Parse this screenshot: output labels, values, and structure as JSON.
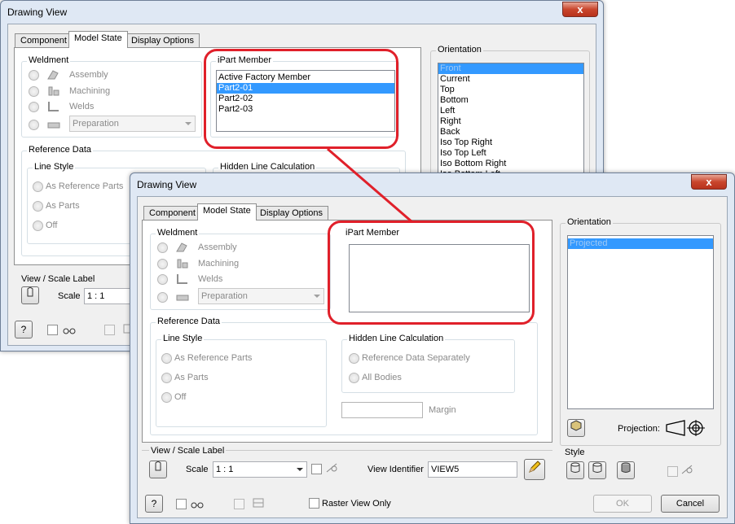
{
  "back": {
    "title": "Drawing View",
    "close": "x",
    "tabs": [
      "Component",
      "Model State",
      "Display Options"
    ],
    "weldment": {
      "label": "Weldment",
      "items": [
        "Assembly",
        "Machining",
        "Welds"
      ],
      "combo": "Preparation"
    },
    "ipart": {
      "label": "iPart Member",
      "items": [
        "Active Factory Member",
        "Part2-01",
        "Part2-02",
        "Part2-03"
      ]
    },
    "reference": {
      "label": "Reference Data",
      "line_style": "Line Style",
      "options": [
        "As Reference Parts",
        "As Parts",
        "Off"
      ],
      "hidden": "Hidden Line Calculation"
    },
    "orientation": {
      "label": "Orientation",
      "items": [
        "Front",
        "Current",
        "Top",
        "Bottom",
        "Left",
        "Right",
        "Back",
        "Iso Top Right",
        "Iso Top Left",
        "Iso Bottom Right",
        "Iso Bottom Left"
      ]
    },
    "view_scale": {
      "label": "View / Scale Label",
      "scale_label": "Scale",
      "scale_value": "1 : 1"
    }
  },
  "front": {
    "title": "Drawing View",
    "close": "x",
    "tabs": [
      "Component",
      "Model State",
      "Display Options"
    ],
    "weldment": {
      "label": "Weldment",
      "items": [
        "Assembly",
        "Machining",
        "Welds"
      ],
      "combo": "Preparation"
    },
    "ipart": {
      "label": "iPart Member"
    },
    "reference": {
      "label": "Reference Data",
      "line_style": "Line Style",
      "options": [
        "As Reference Parts",
        "As Parts",
        "Off"
      ],
      "hidden": "Hidden Line Calculation",
      "hidden_options": [
        "Reference Data Separately",
        "All Bodies"
      ],
      "margin": "Margin"
    },
    "orientation": {
      "label": "Orientation",
      "items": [
        "Projected"
      ],
      "projection_label": "Projection:"
    },
    "view_scale": {
      "label": "View / Scale Label",
      "scale_label": "Scale",
      "scale_value": "1 : 1",
      "view_identifier_label": "View Identifier",
      "view_identifier_value": "VIEW5"
    },
    "style": {
      "label": "Style"
    },
    "bottom": {
      "help": "?",
      "raster": "Raster View Only",
      "ok": "OK",
      "cancel": "Cancel"
    }
  },
  "colors": {
    "highlight": "#e0202a",
    "selection": "#3399ff"
  }
}
